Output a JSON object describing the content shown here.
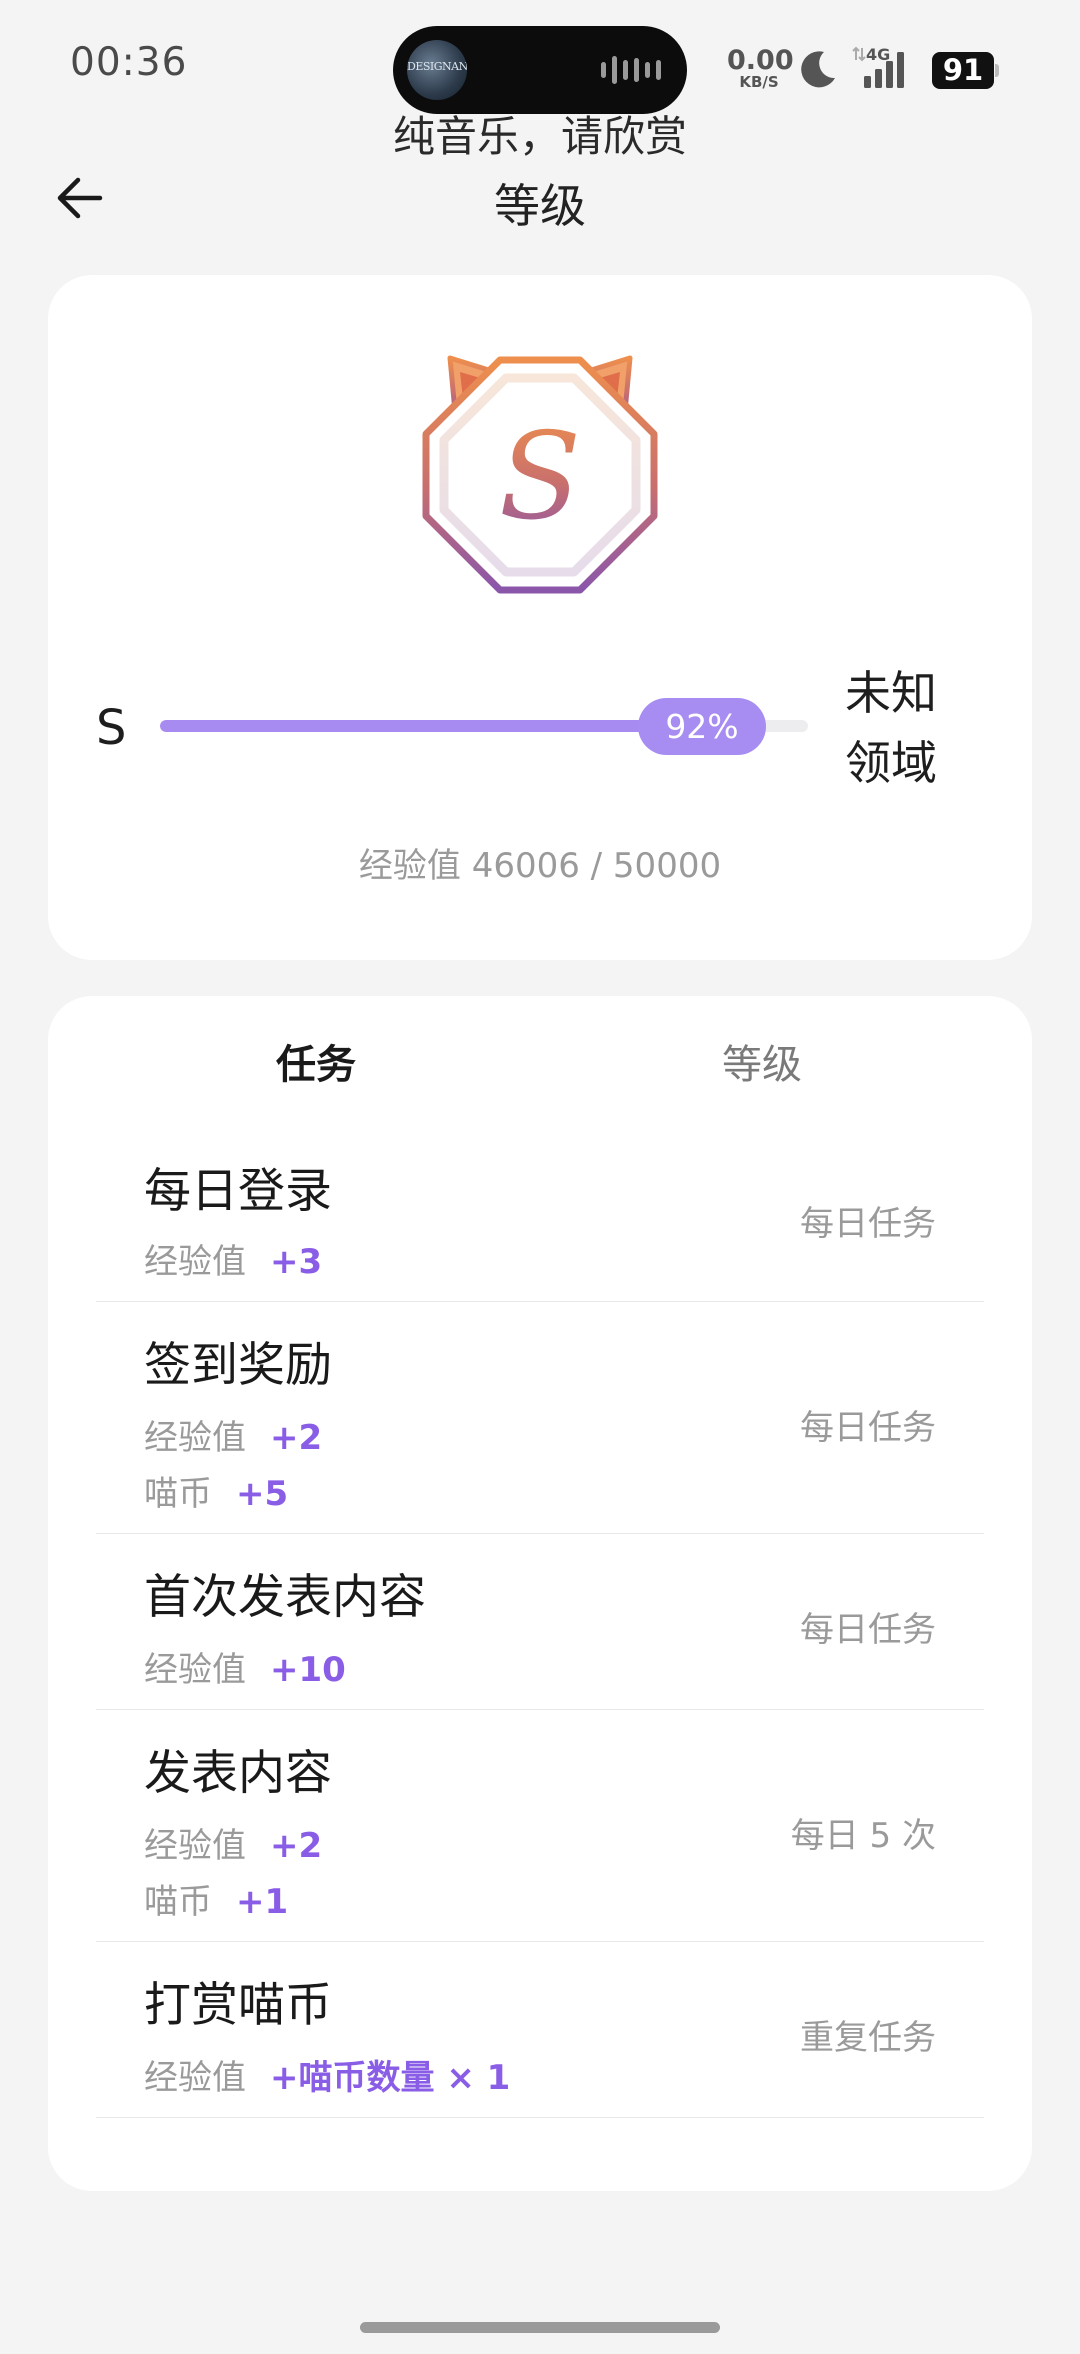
{
  "status_bar": {
    "time": "00:36",
    "net_speed_value": "0.00",
    "net_speed_unit": "KB/S",
    "network": "4G",
    "battery": "91",
    "island_thumb_text": "DESIGNANT"
  },
  "header": {
    "now_playing": "纯音乐，请欣赏",
    "title": "等级"
  },
  "level": {
    "current": "S",
    "next": "未知领域",
    "progress_label": "92%",
    "progress": 0.92,
    "exp_text": "经验值 46006 / 50000",
    "badge_letter": "S"
  },
  "tabs": [
    {
      "label": "任务",
      "active": true
    },
    {
      "label": "等级",
      "active": false
    }
  ],
  "tasks": [
    {
      "title": "每日登录",
      "rewards": [
        {
          "label": "经验值",
          "value": "+3"
        }
      ],
      "frequency": "每日任务"
    },
    {
      "title": "签到奖励",
      "rewards": [
        {
          "label": "经验值",
          "value": "+2"
        },
        {
          "label": "喵币",
          "value": "+5"
        }
      ],
      "frequency": "每日任务"
    },
    {
      "title": "首次发表内容",
      "rewards": [
        {
          "label": "经验值",
          "value": "+10"
        }
      ],
      "frequency": "每日任务"
    },
    {
      "title": "发表内容",
      "rewards": [
        {
          "label": "经验值",
          "value": "+2"
        },
        {
          "label": "喵币",
          "value": "+1"
        }
      ],
      "frequency": "每日 5 次"
    },
    {
      "title": "打赏喵币",
      "rewards": [
        {
          "label": "经验值",
          "value": "+喵币数量 × 1"
        }
      ],
      "frequency": "重复任务"
    }
  ],
  "colors": {
    "accent": "#8a5de6",
    "progress_fill": "#a88bf0",
    "badge_orange": "#e8884f",
    "badge_purple": "#8c57a8"
  }
}
